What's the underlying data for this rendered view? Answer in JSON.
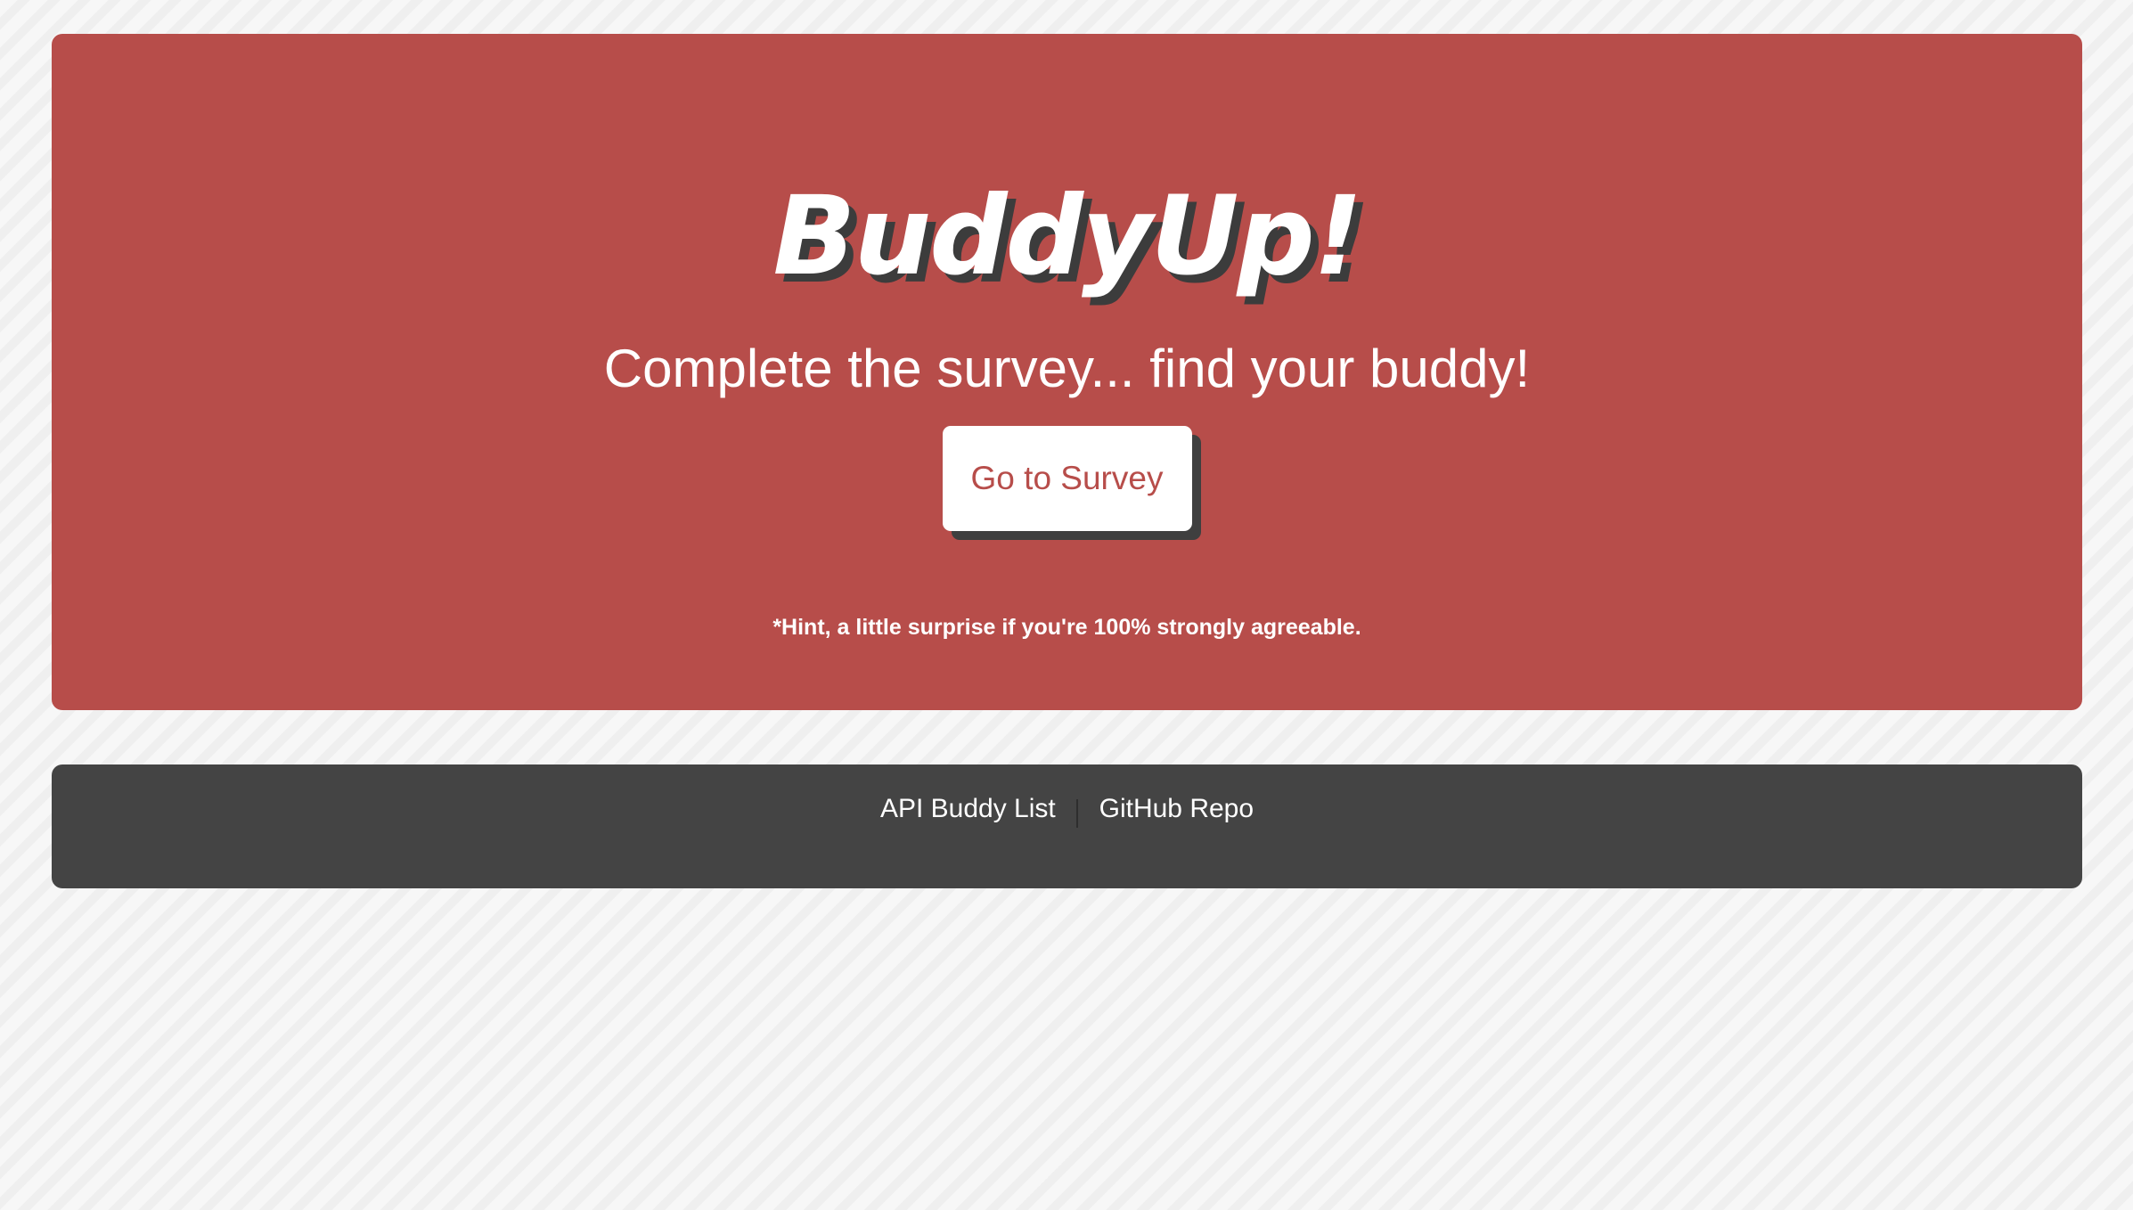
{
  "hero": {
    "brand": "BuddyUp!",
    "tagline": "Complete the survey... find your buddy!",
    "cta_label": "Go to Survey",
    "hint": "*Hint, a little surprise if you're 100% strongly agreeable."
  },
  "footer": {
    "links": [
      {
        "label": "API Buddy List"
      },
      {
        "label": "GitHub Repo"
      }
    ]
  },
  "colors": {
    "hero_background": "#b74d4a",
    "footer_background": "#444444",
    "button_text": "#b74d4a",
    "shadow": "#3c3c3c"
  }
}
